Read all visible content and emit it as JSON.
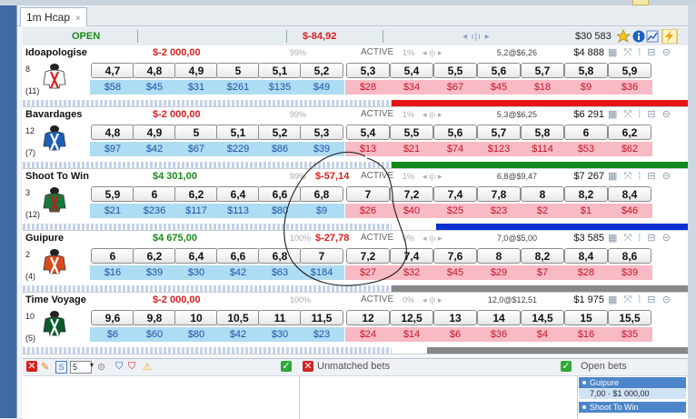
{
  "tab": {
    "label": "1m Hcap",
    "close": "×"
  },
  "market": {
    "status": "OPEN",
    "worst_case": "$-84,92",
    "bars_glyph": "◂ ı|ı ▸",
    "total_matched": "$30 583",
    "icons": [
      "star-icon",
      "info-icon",
      "chart-icon",
      "lightning-icon"
    ]
  },
  "runners": [
    {
      "name": "Idoapologise",
      "pl": "$-2 000,00",
      "pl_sign": "neg",
      "pct": "99%",
      "active": "ACTIVE",
      "pct2": "1%",
      "at": "5,2@$6,26",
      "matched": "$4 888",
      "num": "8",
      "draw": "(11)",
      "silk": {
        "body": "#ffffff",
        "accent": "#d92222"
      },
      "back": [
        {
          "o": "4,7",
          "a": "$58"
        },
        {
          "o": "4,8",
          "a": "$45"
        },
        {
          "o": "4,9",
          "a": "$31"
        },
        {
          "o": "5",
          "a": "$261"
        },
        {
          "o": "5,1",
          "a": "$135"
        },
        {
          "o": "5,2",
          "a": "$49"
        }
      ],
      "lay": [
        {
          "o": "5,3",
          "a": "$28"
        },
        {
          "o": "5,4",
          "a": "$34"
        },
        {
          "o": "5,5",
          "a": "$67"
        },
        {
          "o": "5,6",
          "a": "$45"
        },
        {
          "o": "5,7",
          "a": "$18"
        },
        {
          "o": "5,8",
          "a": "$9"
        },
        {
          "o": "5,9",
          "a": "$36"
        }
      ],
      "stripe_color": "#e41515",
      "stripe_fill": 1.0
    },
    {
      "name": "Bavardages",
      "pl": "$-2 000,00",
      "pl_sign": "neg",
      "pct": "99%",
      "active": "ACTIVE",
      "pct2": "1%",
      "at": "5,3@$6,25",
      "matched": "$6 291",
      "num": "12",
      "draw": "(7)",
      "silk": {
        "body": "#1d5fb8",
        "accent": "#ffffff"
      },
      "back": [
        {
          "o": "4,8",
          "a": "$97"
        },
        {
          "o": "4,9",
          "a": "$42"
        },
        {
          "o": "5",
          "a": "$67"
        },
        {
          "o": "5,1",
          "a": "$229"
        },
        {
          "o": "5,2",
          "a": "$86"
        },
        {
          "o": "5,3",
          "a": "$39"
        }
      ],
      "lay": [
        {
          "o": "5,4",
          "a": "$13"
        },
        {
          "o": "5,5",
          "a": "$21"
        },
        {
          "o": "5,6",
          "a": "$74"
        },
        {
          "o": "5,7",
          "a": "$123"
        },
        {
          "o": "5,8",
          "a": "$114"
        },
        {
          "o": "6",
          "a": "$53"
        },
        {
          "o": "6,2",
          "a": "$62"
        }
      ],
      "stripe_color": "#13891c",
      "stripe_fill": 1.0
    },
    {
      "name": "Shoot To Win",
      "pl": "$4 301,00",
      "pl_sign": "pos",
      "pct": "99%",
      "active": "ACTIVE",
      "pct2": "1%",
      "at": "6,8@$9,47",
      "matched": "$7 267",
      "num": "3",
      "draw": "(12)",
      "silk": {
        "body": "#137a3a",
        "accent": "#c21a1a"
      },
      "back": [
        {
          "o": "5,9",
          "a": "$21"
        },
        {
          "o": "6",
          "a": "$236"
        },
        {
          "o": "6,2",
          "a": "$117"
        },
        {
          "o": "6,4",
          "a": "$113"
        },
        {
          "o": "6,6",
          "a": "$80"
        },
        {
          "o": "6,8",
          "a": "$9"
        }
      ],
      "lay": [
        {
          "o": "7",
          "a": "$26"
        },
        {
          "o": "7,2",
          "a": "$40"
        },
        {
          "o": "7,4",
          "a": "$25"
        },
        {
          "o": "7,8",
          "a": "$23"
        },
        {
          "o": "8",
          "a": "$2"
        },
        {
          "o": "8,2",
          "a": "$1"
        },
        {
          "o": "8,4",
          "a": "$46"
        }
      ],
      "stripe_color": "#0a2fd1",
      "stripe_fill": 0.85,
      "overlay_pl": "$-57,14"
    },
    {
      "name": "Guipure",
      "pl": "$4 675,00",
      "pl_sign": "pos",
      "pct": "100%",
      "active": "ACTIVE",
      "pct2": "0%",
      "at": "7,0@$5,00",
      "matched": "$3 585",
      "num": "2",
      "draw": "(4)",
      "silk": {
        "body": "#d84a1c",
        "accent": "#ffffff"
      },
      "back": [
        {
          "o": "6",
          "a": "$16"
        },
        {
          "o": "6,2",
          "a": "$39"
        },
        {
          "o": "6,4",
          "a": "$30"
        },
        {
          "o": "6,6",
          "a": "$42"
        },
        {
          "o": "6,8",
          "a": "$63"
        },
        {
          "o": "7",
          "a": "$184"
        }
      ],
      "lay": [
        {
          "o": "7,2",
          "a": "$27"
        },
        {
          "o": "7,4",
          "a": "$32"
        },
        {
          "o": "7,6",
          "a": "$45"
        },
        {
          "o": "8",
          "a": "$29"
        },
        {
          "o": "8,2",
          "a": "$7"
        },
        {
          "o": "8,4",
          "a": "$28"
        },
        {
          "o": "8,6",
          "a": "$39"
        }
      ],
      "stripe_color": "#888888",
      "stripe_fill": 1.0,
      "overlay_pl": "$-27,78"
    },
    {
      "name": "Time Voyage",
      "pl": "$-2 000,00",
      "pl_sign": "neg",
      "pct": "100%",
      "active": "ACTIVE",
      "pct2": "0%",
      "at": "12,0@$12,51",
      "matched": "$1 975",
      "num": "10",
      "draw": "(5)",
      "silk": {
        "body": "#0b5b2e",
        "accent": "#ffffff"
      },
      "back": [
        {
          "o": "9,6",
          "a": "$6"
        },
        {
          "o": "9,8",
          "a": "$60"
        },
        {
          "o": "10",
          "a": "$80"
        },
        {
          "o": "10,5",
          "a": "$42"
        },
        {
          "o": "11",
          "a": "$30"
        },
        {
          "o": "11,5",
          "a": "$23"
        }
      ],
      "lay": [
        {
          "o": "12",
          "a": "$24"
        },
        {
          "o": "12,5",
          "a": "$14"
        },
        {
          "o": "13",
          "a": "$6"
        },
        {
          "o": "14",
          "a": "$36"
        },
        {
          "o": "14,5",
          "a": "$4"
        },
        {
          "o": "15",
          "a": "$16"
        },
        {
          "o": "15,5",
          "a": "$35"
        }
      ],
      "stripe_color": "#888888",
      "stripe_fill": 0.88
    }
  ],
  "bottom": {
    "stake_value": "5",
    "unmatched_label": "Unmatched bets",
    "open_label": "Open bets",
    "open_items": [
      {
        "name": "Guipure",
        "detail": "7,00 · $1 000,00"
      },
      {
        "name": "Shoot To Win",
        "detail": ""
      }
    ]
  }
}
